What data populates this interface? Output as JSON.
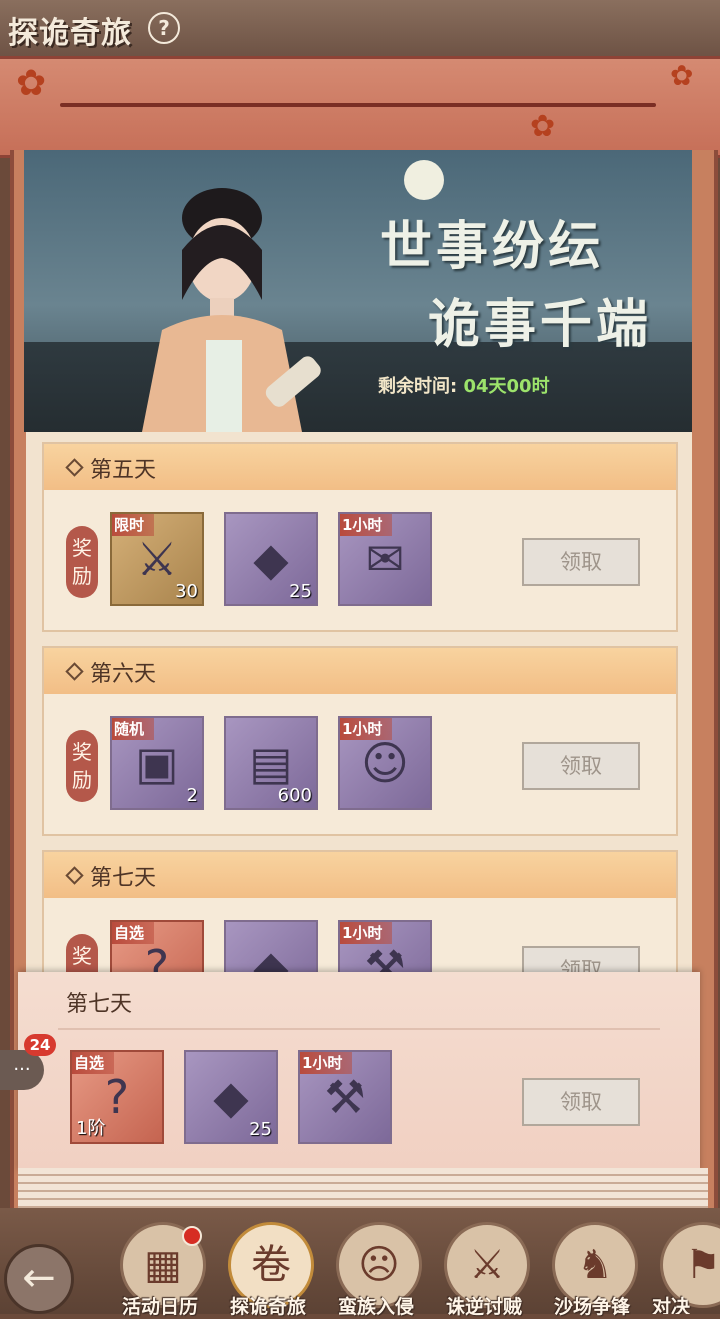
{
  "header": {
    "title": "探诡奇旅",
    "help_icon": "?"
  },
  "banner": {
    "slogan_line1": "世事纷纭",
    "slogan_line2": "诡事千端",
    "time_label": "剩余时间:",
    "time_value": "04天00时"
  },
  "days": [
    {
      "title": "第五天",
      "reward_label": "奖励",
      "items": [
        {
          "tag": "限时",
          "count": "30",
          "icon": "sword-icon",
          "glyph": "⚔"
        },
        {
          "tag": "",
          "count": "25",
          "icon": "robe-stone-icon",
          "glyph": "◆"
        },
        {
          "tag": "1小时",
          "count": "",
          "icon": "scroll-speedup-icon",
          "glyph": "✉"
        }
      ],
      "claim_label": "领取"
    },
    {
      "title": "第六天",
      "reward_label": "奖励",
      "items": [
        {
          "tag": "随机",
          "count": "2",
          "icon": "chest-icon",
          "glyph": "▣"
        },
        {
          "tag": "",
          "count": "600",
          "icon": "book-icon",
          "glyph": "▤"
        },
        {
          "tag": "1小时",
          "count": "",
          "icon": "soldier-speedup-icon",
          "glyph": "☺"
        }
      ],
      "claim_label": "领取"
    },
    {
      "title": "第七天",
      "reward_label": "奖励",
      "items": [
        {
          "tag": "自选",
          "count": "",
          "icon": "mystery-gem-icon",
          "glyph": "?"
        },
        {
          "tag": "",
          "count": "",
          "icon": "robe-stone-icon",
          "glyph": "◆"
        },
        {
          "tag": "1小时",
          "count": "",
          "icon": "hammer-speedup-icon",
          "glyph": "⚒"
        }
      ],
      "claim_label": "领取"
    }
  ],
  "popup": {
    "title": "第七天",
    "items": [
      {
        "tag": "自选",
        "count": "1阶",
        "icon": "mystery-gem-icon",
        "glyph": "?"
      },
      {
        "tag": "",
        "count": "25",
        "icon": "robe-stone-icon",
        "glyph": "◆"
      },
      {
        "tag": "1小时",
        "count": "",
        "icon": "hammer-speedup-icon",
        "glyph": "⚒"
      }
    ],
    "claim_label": "领取"
  },
  "chat": {
    "badge": "24",
    "glyph": "···"
  },
  "nav": {
    "back_glyph": "←",
    "items": [
      {
        "label": "活动日历",
        "glyph": "▦",
        "dot": true
      },
      {
        "label": "探诡奇旅",
        "glyph": "卷",
        "dot": false
      },
      {
        "label": "蛮族入侵",
        "glyph": "☹",
        "dot": false
      },
      {
        "label": "诛逆讨贼",
        "glyph": "⚔",
        "dot": false
      },
      {
        "label": "沙场争锋",
        "glyph": "♞",
        "dot": false
      },
      {
        "label": "对决",
        "glyph": "⚑",
        "dot": false
      }
    ]
  },
  "colors": {
    "accent_red": "#b94b3c",
    "time_green": "#9ce36b",
    "badge_red": "#d73a2f"
  }
}
